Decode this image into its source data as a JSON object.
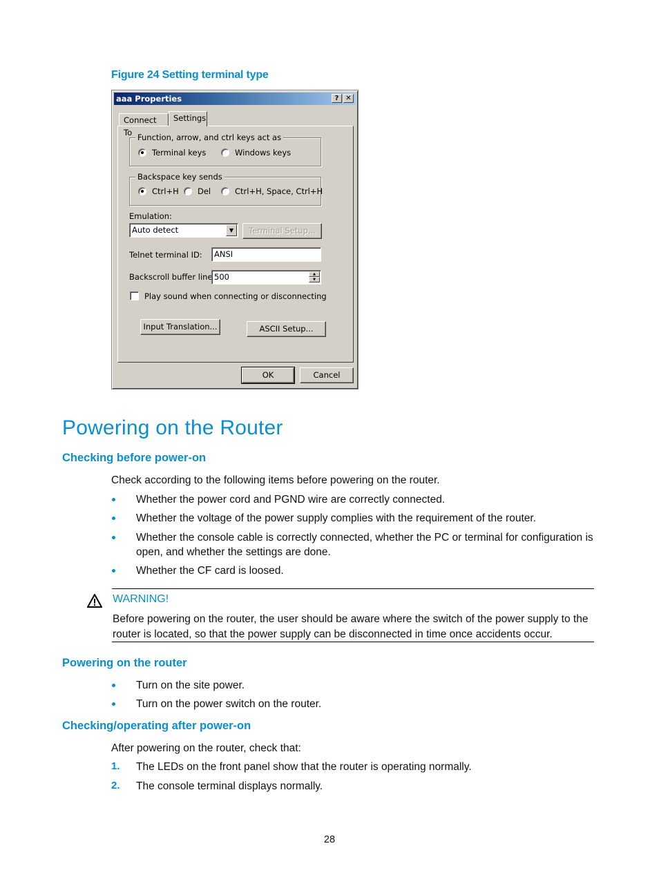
{
  "figure": {
    "caption": "Figure 24 Setting terminal type"
  },
  "dialog": {
    "title": "aaa Properties",
    "help_button": "?",
    "close_button": "✕",
    "tabs": [
      {
        "label": "Connect To",
        "active": false
      },
      {
        "label": "Settings",
        "active": true
      }
    ],
    "function_keys_group": {
      "legend": "Function, arrow, and ctrl keys act as",
      "options": [
        {
          "label": "Terminal keys",
          "checked": true
        },
        {
          "label": "Windows keys",
          "checked": false
        }
      ]
    },
    "backspace_group": {
      "legend": "Backspace key sends",
      "options": [
        {
          "label": "Ctrl+H",
          "checked": true
        },
        {
          "label": "Del",
          "checked": false
        },
        {
          "label": "Ctrl+H, Space, Ctrl+H",
          "checked": false
        }
      ]
    },
    "emulation": {
      "label": "Emulation:",
      "value": "Auto detect"
    },
    "terminal_setup_button": "Terminal Setup...",
    "telnet_id": {
      "label": "Telnet terminal ID:",
      "value": "ANSI"
    },
    "backscroll": {
      "label": "Backscroll buffer lines:",
      "value": "500"
    },
    "play_sound": {
      "label": "Play sound when connecting or disconnecting",
      "checked": false
    },
    "input_translation_button": "Input Translation...",
    "ascii_setup_button": "ASCII Setup...",
    "ok_button": "OK",
    "cancel_button": "Cancel"
  },
  "section": {
    "title": "Powering on the Router",
    "checking_before": {
      "heading": "Checking before power-on",
      "intro": "Check according to the following items before powering on the router.",
      "items": [
        "Whether the power cord and PGND wire are correctly connected.",
        "Whether the voltage of the power supply complies with the requirement of the router.",
        "Whether the console cable is correctly connected, whether the PC or terminal for configuration is",
        "open, and whether the settings are done.",
        "Whether the CF card is loosed."
      ]
    },
    "warning": {
      "label": "WARNING!",
      "line1": "Before powering on the router, the user should be aware where the switch of the power supply to the",
      "line2": "router is located, so that the power supply can be disconnected in time once accidents occur."
    },
    "powering_on": {
      "heading": "Powering on the router",
      "items": [
        "Turn on the site power.",
        "Turn on the power switch on the router."
      ]
    },
    "checking_after": {
      "heading": "Checking/operating after power-on",
      "intro": "After powering on the router, check that:",
      "steps": [
        {
          "num": "1.",
          "text": "The LEDs on the front panel show that the router is operating normally."
        },
        {
          "num": "2.",
          "text": "The console terminal displays normally."
        }
      ]
    }
  },
  "page_number": "28"
}
